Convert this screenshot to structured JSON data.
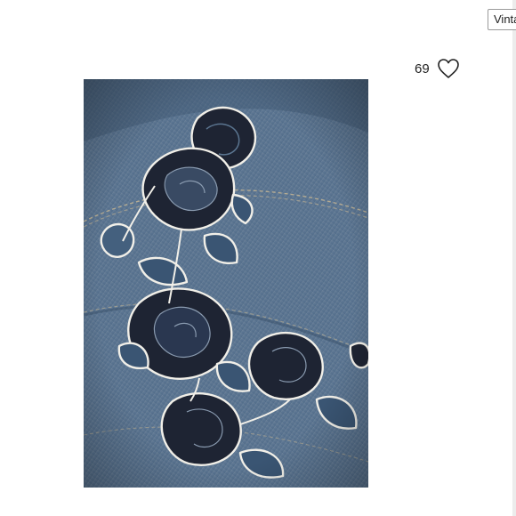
{
  "listing": {
    "tag_label": "Vintage",
    "like_count": "69"
  },
  "photo": {
    "subject": "embroidered-denim-photo"
  },
  "colors": {
    "denim": "#5b7590",
    "embroidery": "#1e2433",
    "outline": "#f1efe8"
  }
}
